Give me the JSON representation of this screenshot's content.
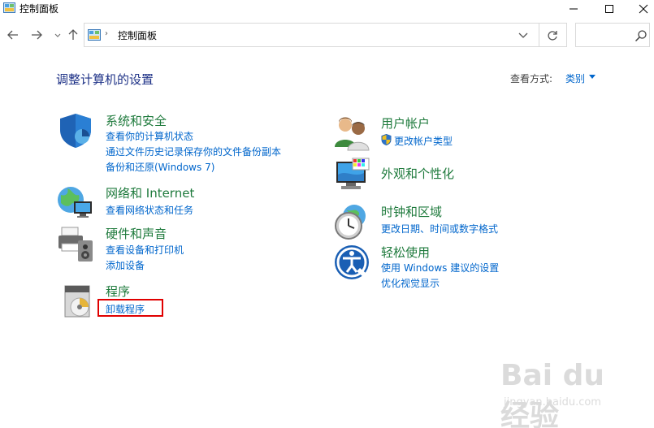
{
  "window": {
    "title": "控制面板",
    "icons": [
      "control-panel-icon",
      "minimize-icon",
      "maximize-icon",
      "close-icon"
    ]
  },
  "navigation": {
    "address_path": "控制面板",
    "search_placeholder": "",
    "icons": [
      "back-arrow-icon",
      "forward-arrow-icon",
      "recent-locations-icon",
      "up-arrow-icon",
      "dropdown-icon",
      "refresh-icon",
      "search-icon"
    ]
  },
  "main": {
    "title": "调整计算机的设置",
    "view_by_label": "查看方式:",
    "view_by_value": "类别"
  },
  "categories": {
    "system_security": {
      "title": "系统和安全",
      "icon": "shield-icon",
      "links": [
        "查看你的计算机状态",
        "通过文件历史记录保存你的文件备份副本",
        "备份和还原(Windows 7)"
      ]
    },
    "network": {
      "title": "网络和 Internet",
      "icon": "network-globe-icon",
      "links": [
        "查看网络状态和任务"
      ]
    },
    "hardware": {
      "title": "硬件和声音",
      "icon": "printer-speaker-icon",
      "links": [
        "查看设备和打印机",
        "添加设备"
      ]
    },
    "programs": {
      "title": "程序",
      "icon": "programs-disc-icon",
      "links": [
        "卸载程序"
      ]
    },
    "user_accounts": {
      "title": "用户帐户",
      "icon": "users-icon",
      "links": [
        "更改帐户类型"
      ]
    },
    "appearance": {
      "title": "外观和个性化",
      "icon": "monitor-palette-icon",
      "links": []
    },
    "clock_region": {
      "title": "时钟和区域",
      "icon": "clock-globe-icon",
      "links": [
        "更改日期、时间或数字格式"
      ]
    },
    "ease_of_access": {
      "title": "轻松使用",
      "icon": "ease-of-access-icon",
      "links": [
        "使用 Windows 建议的设置",
        "优化视觉显示"
      ]
    }
  },
  "watermark": {
    "brand": "Bai du 经验",
    "sub": "jingyan.baidu.com"
  },
  "colors": {
    "category_title": "#1e7a3c",
    "link": "#0066cc",
    "page_title": "#1e3287",
    "highlight": "#e00000"
  }
}
